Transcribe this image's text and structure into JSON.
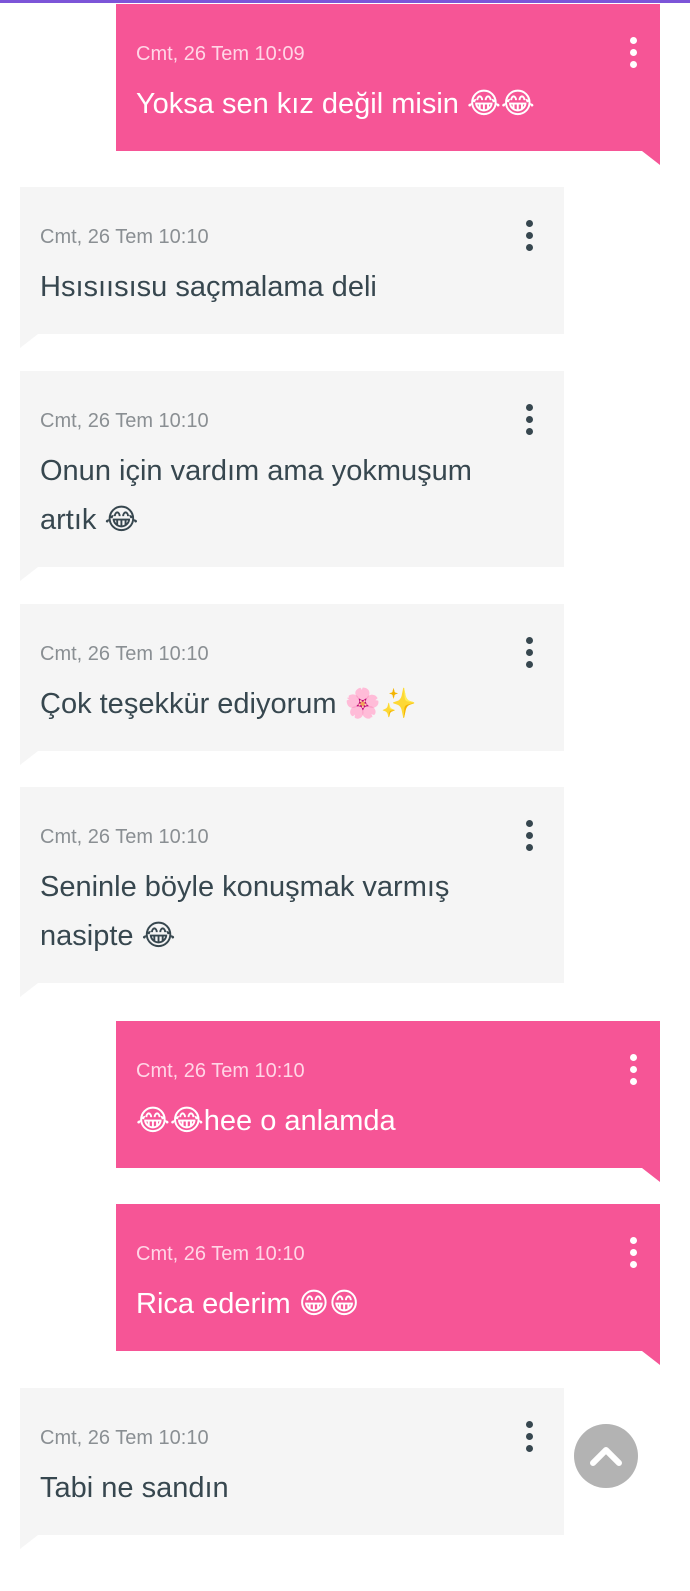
{
  "messages": [
    {
      "type": "sent",
      "time": "Cmt, 26 Tem 10:09",
      "text": "Yoksa sen kız değil misin 😂😂"
    },
    {
      "type": "recv",
      "time": "Cmt, 26 Tem 10:10",
      "text": "Hsısıısısu saçmalama deli"
    },
    {
      "type": "recv",
      "time": "Cmt, 26 Tem 10:10",
      "text": "Onun için vardım ama yokmuşum\nartık 😂"
    },
    {
      "type": "recv",
      "time": "Cmt, 26 Tem 10:10",
      "text": "Çok teşekkür ediyorum 🌸✨"
    },
    {
      "type": "recv",
      "time": "Cmt, 26 Tem 10:10",
      "text": "Seninle böyle konuşmak varmış\nnasipte 😂"
    },
    {
      "type": "sent",
      "time": "Cmt, 26 Tem 10:10",
      "text": "😂😂hee o anlamda"
    },
    {
      "type": "sent",
      "time": "Cmt, 26 Tem 10:10",
      "text": "Rica ederim 😁😁"
    },
    {
      "type": "recv",
      "time": "Cmt, 26 Tem 10:10",
      "text": "Tabi ne sandın"
    }
  ],
  "icons": {
    "message_menu": "more-vert-icon",
    "scroll_top": "chevron-up-icon"
  },
  "colors": {
    "sent_bubble": "#f65596",
    "received_bubble": "#f5f5f5",
    "received_text": "#37474f",
    "top_accent": "#7c55d8",
    "scroll_button": "#b3b3b3"
  }
}
